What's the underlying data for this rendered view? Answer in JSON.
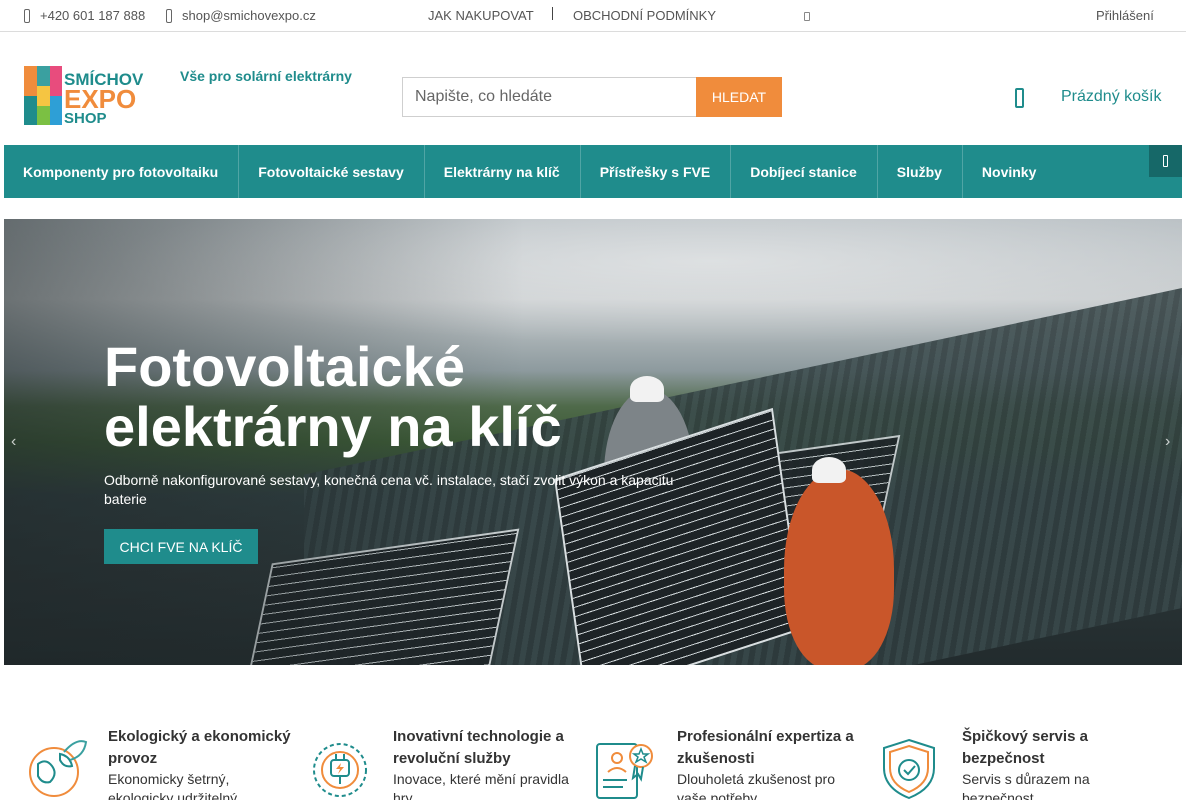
{
  "topbar": {
    "phone": "+420 601 187 888",
    "email": "shop@smichovexpo.cz",
    "how_to_buy": "JAK NAKUPOVAT",
    "terms": "OBCHODNÍ PODMÍNKY",
    "login": "Přihlášení"
  },
  "header": {
    "logo_lines": [
      "SMÍCHOV",
      "EXPO",
      "SHOP"
    ],
    "tagline": "Vše pro solární elektrárny",
    "search_placeholder": "Napište, co hledáte",
    "search_button": "HLEDAT",
    "cart_label": "Prázdný košík"
  },
  "nav": {
    "items": [
      "Komponenty pro fotovoltaiku",
      "Fotovoltaické sestavy",
      "Elektrárny na klíč",
      "Přístřešky s FVE",
      "Dobíjecí stanice",
      "Služby",
      "Novinky"
    ]
  },
  "hero": {
    "title_line1": "Fotovoltaické",
    "title_line2": "elektrárny na klíč",
    "subtitle": "Odborně nakonfigurované sestavy, konečná cena vč. instalace, stačí zvolit výkon a kapacitu baterie",
    "button": "CHCI FVE NA KLÍČ",
    "prev_arrow": "‹",
    "next_arrow": "›"
  },
  "features": [
    {
      "title": "Ekologický a ekonomický provoz",
      "text": "Ekonomicky šetrný, ekologicky udržitelný",
      "icon": "eco-globe-icon"
    },
    {
      "title": "Inovativní technologie a revoluční služby",
      "text": "Inovace, které mění pravidla hry",
      "icon": "power-plug-icon"
    },
    {
      "title": "Profesionální expertiza a zkušenosti",
      "text": "Dlouholetá zkušenost pro vaše potřeby",
      "icon": "certificate-icon"
    },
    {
      "title": "Špičkový servis a bezpečnost",
      "text": "Servis s důrazem na bezpečnost",
      "icon": "shield-check-icon"
    }
  ],
  "colors": {
    "accent": "#1f8c8c",
    "button": "#f08c3c"
  }
}
